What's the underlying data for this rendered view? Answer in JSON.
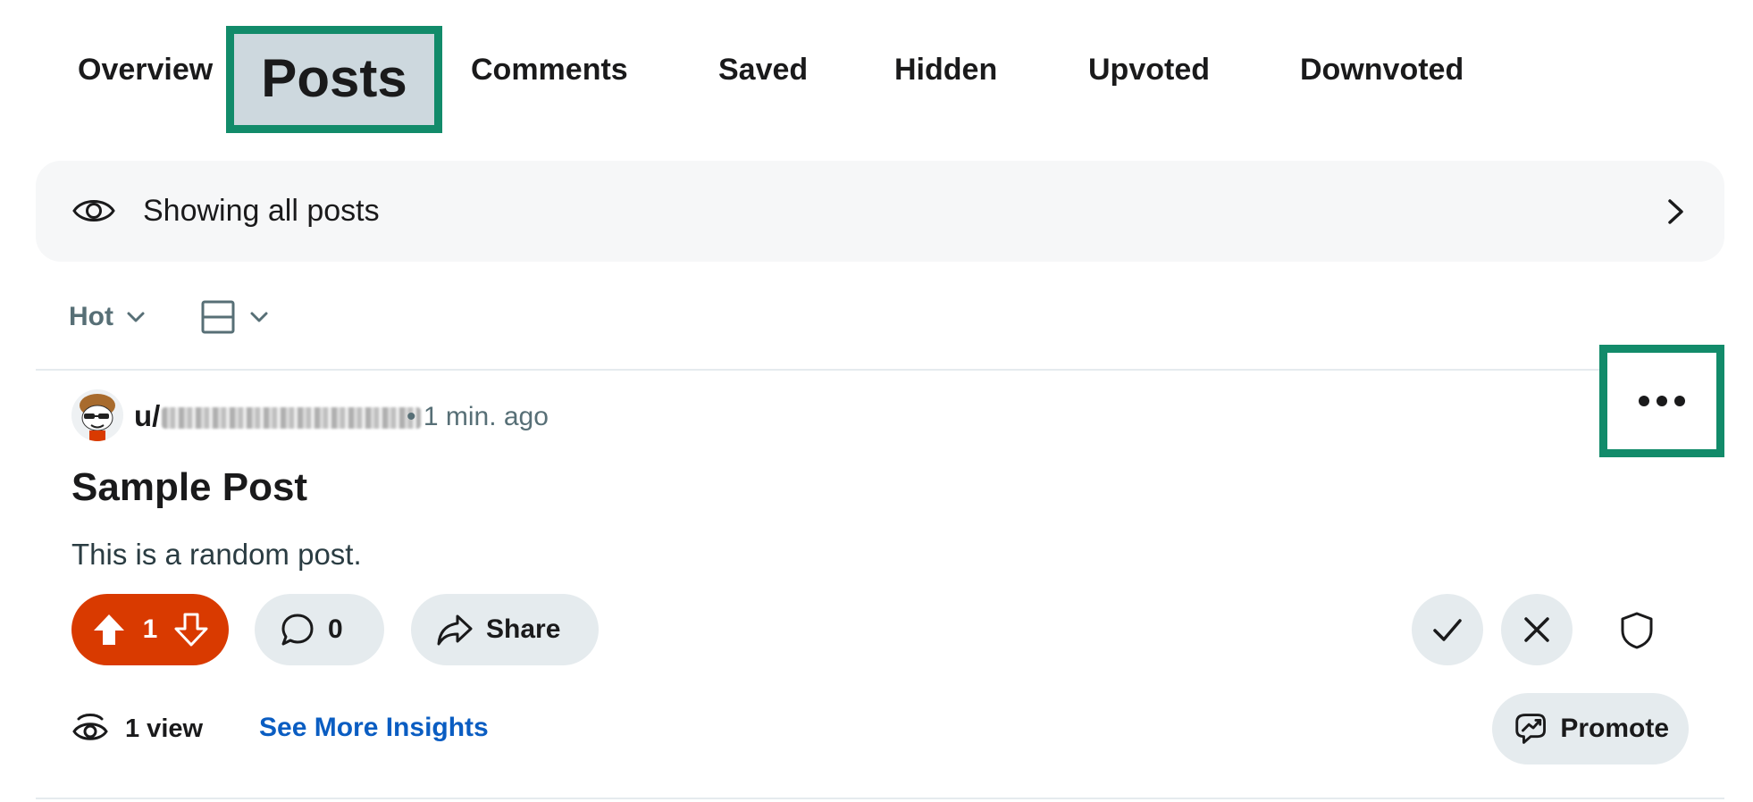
{
  "tabs": [
    {
      "label": "Overview"
    },
    {
      "label": "Posts"
    },
    {
      "label": "Comments"
    },
    {
      "label": "Saved"
    },
    {
      "label": "Hidden"
    },
    {
      "label": "Upvoted"
    },
    {
      "label": "Downvoted"
    }
  ],
  "active_tab": "Posts",
  "filter": {
    "label": "Showing all posts"
  },
  "sort": {
    "label": "Hot"
  },
  "post": {
    "author_prefix": "u/",
    "meta": "• 1 min. ago",
    "title": "Sample Post",
    "body": "This is a random post.",
    "votes": "1",
    "comments": "0",
    "share_label": "Share"
  },
  "insights": {
    "views": "1 view",
    "link": "See More Insights",
    "promote": "Promote"
  },
  "colors": {
    "vote_bg": "#d93a00",
    "highlight_border": "#128b6a",
    "link": "#0a5dc2",
    "pill_bg": "#e5ebee"
  },
  "icons": [
    "eye-icon",
    "chevron-right-icon",
    "chevron-down-icon",
    "layout-icon",
    "more-icon",
    "upvote-icon",
    "downvote-icon",
    "comment-icon",
    "share-icon",
    "check-icon",
    "close-icon",
    "shield-icon",
    "views-icon",
    "promote-icon"
  ]
}
